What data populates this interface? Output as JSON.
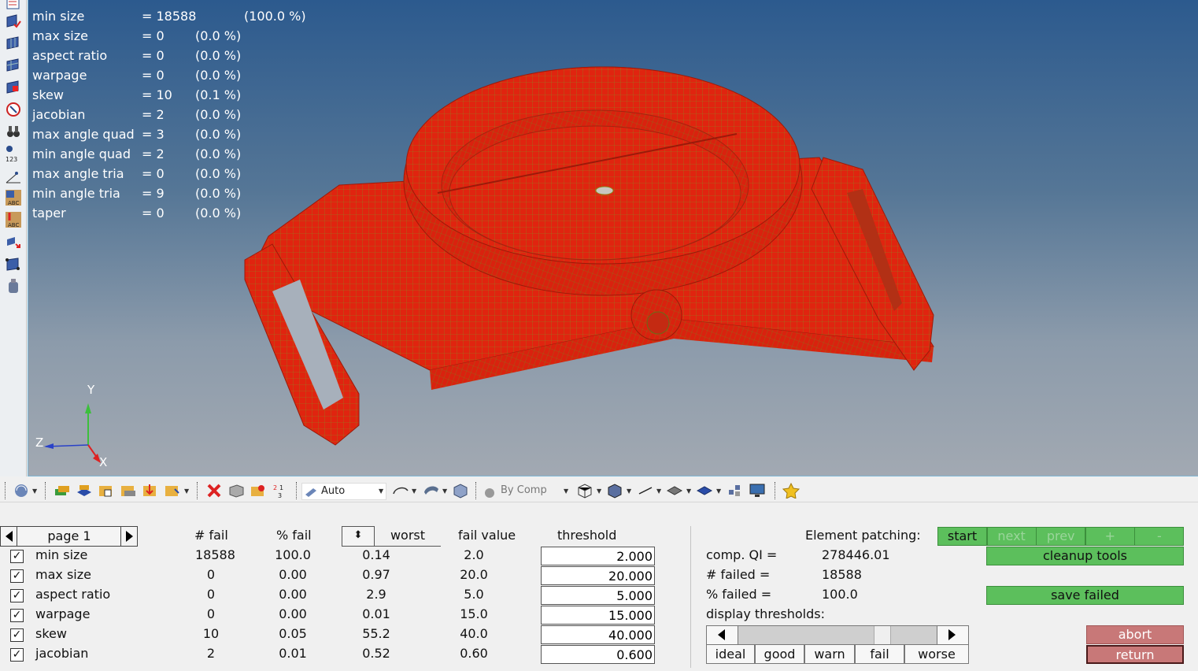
{
  "viewport": {
    "stats": [
      {
        "name": "min size",
        "value": "= 18588",
        "pct": "(100.0 %)"
      },
      {
        "name": "max size",
        "value": "= 0",
        "pct": "(0.0 %)"
      },
      {
        "name": "aspect ratio",
        "value": "= 0",
        "pct": "(0.0 %)"
      },
      {
        "name": "warpage",
        "value": "= 0",
        "pct": "(0.0 %)"
      },
      {
        "name": "skew",
        "value": "= 10",
        "pct": "(0.1 %)"
      },
      {
        "name": "jacobian",
        "value": "= 2",
        "pct": "(0.0 %)"
      },
      {
        "name": "max angle quad",
        "value": "= 3",
        "pct": "(0.0 %)"
      },
      {
        "name": "min angle quad",
        "value": "= 2",
        "pct": "(0.0 %)"
      },
      {
        "name": "max angle tria",
        "value": "= 0",
        "pct": "(0.0 %)"
      },
      {
        "name": "min angle tria",
        "value": "= 9",
        "pct": "(0.0 %)"
      },
      {
        "name": "taper",
        "value": "= 0",
        "pct": "(0.0 %)"
      }
    ],
    "triad": {
      "y": "Y",
      "z": "Z",
      "x": "X"
    },
    "mesh_color": "#e0240f",
    "mesh_line_color": "#8a8a20"
  },
  "toolbar": {
    "auto_select": "Auto",
    "comp_select": "By Comp"
  },
  "panel": {
    "page_label": "page 1",
    "headers": {
      "fail": "# fail",
      "pct_fail": "% fail",
      "worst": "worst",
      "fail_value": "fail value",
      "threshold": "threshold"
    },
    "rows": [
      {
        "name": "min size",
        "fail": "18588",
        "pct": "100.0",
        "worst": "0.14",
        "fail_value": "2.0",
        "threshold": "2.000"
      },
      {
        "name": "max size",
        "fail": "0",
        "pct": "0.00",
        "worst": "0.97",
        "fail_value": "20.0",
        "threshold": "20.000"
      },
      {
        "name": "aspect ratio",
        "fail": "0",
        "pct": "0.00",
        "worst": "2.9",
        "fail_value": "5.0",
        "threshold": "5.000"
      },
      {
        "name": "warpage",
        "fail": "0",
        "pct": "0.00",
        "worst": "0.01",
        "fail_value": "15.0",
        "threshold": "15.000"
      },
      {
        "name": "skew",
        "fail": "10",
        "pct": "0.05",
        "worst": "55.2",
        "fail_value": "40.0",
        "threshold": "40.000"
      },
      {
        "name": "jacobian",
        "fail": "2",
        "pct": "0.01",
        "worst": "0.52",
        "fail_value": "0.60",
        "threshold": "0.600"
      }
    ],
    "element_patching_label": "Element patching:",
    "patch_buttons": [
      "start",
      "next",
      "prev",
      "+",
      "-"
    ],
    "cleanup_tools": "cleanup tools",
    "save_failed": "save failed",
    "comp_qi_label": "comp. QI =",
    "comp_qi_value": "278446.01",
    "failed_count_label": "# failed =",
    "failed_count_value": "18588",
    "failed_pct_label": "% failed =",
    "failed_pct_value": "100.0",
    "display_thresholds": "display thresholds:",
    "threshold_buttons": [
      "ideal",
      "good",
      "warn",
      "fail",
      "worse"
    ],
    "abort": "abort",
    "return": "return"
  }
}
